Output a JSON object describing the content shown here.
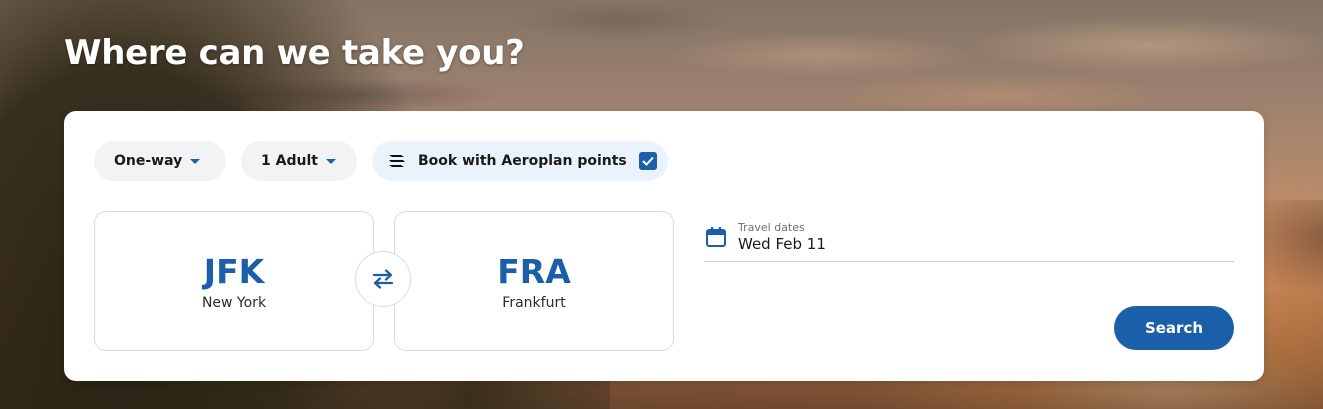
{
  "hero": {
    "headline": "Where can we take you?"
  },
  "search": {
    "trip_type": "One-way",
    "passengers": "1 Adult",
    "points_label": "Book with Aeroplan points",
    "points_checked": true,
    "origin": {
      "code": "JFK",
      "city": "New York"
    },
    "destination": {
      "code": "FRA",
      "city": "Frankfurt"
    },
    "dates_label": "Travel dates",
    "dates_value": "Wed Feb 11",
    "search_label": "Search"
  },
  "icons": {
    "caret": "chevron-down-icon",
    "points": "aeroplan-icon",
    "checkbox": "checkmark-icon",
    "swap": "swap-arrows-icon",
    "calendar": "calendar-icon"
  },
  "colors": {
    "accent": "#1a5fa8",
    "card_bg": "#ffffff",
    "pill_bg": "#f2f3f5",
    "points_pill_bg": "#eaf2fb",
    "text_primary": "#1a1a1a"
  }
}
